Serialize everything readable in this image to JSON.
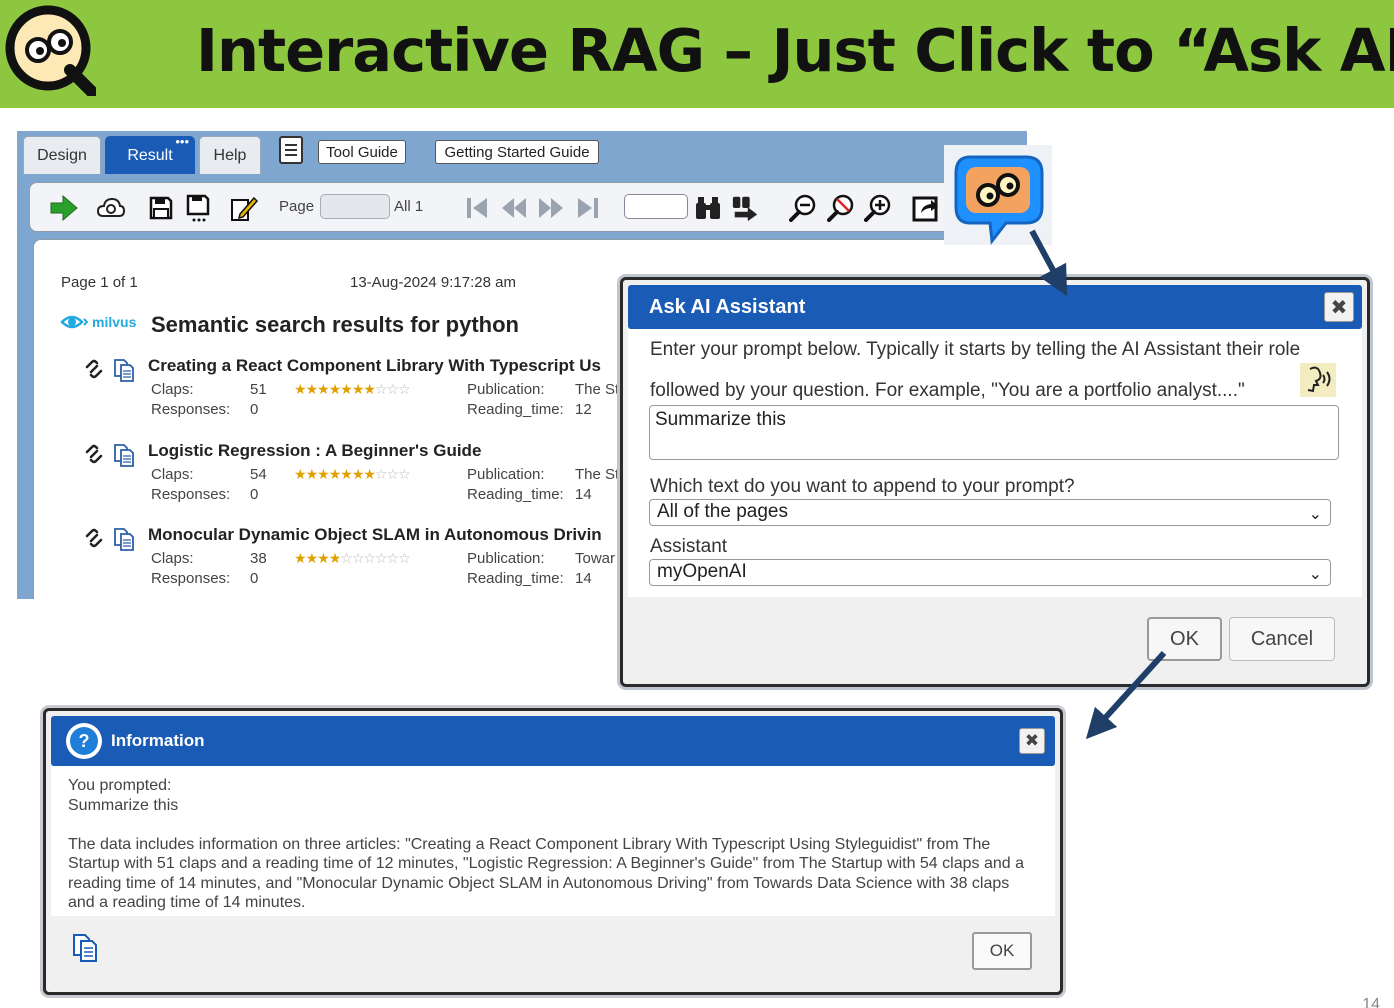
{
  "slide": {
    "title": "Interactive RAG – Just Click to “Ask AI”",
    "page_number": "14",
    "logo_icon": "eyeglasses-q-logo",
    "header_color": "#8dc63f"
  },
  "viewer": {
    "tabs": [
      {
        "label": "Design",
        "active": false
      },
      {
        "label": "Result",
        "active": true
      },
      {
        "label": "Help",
        "active": false
      }
    ],
    "buttons": {
      "tool_guide": "Tool Guide",
      "getting_started": "Getting Started Guide"
    },
    "toolbar": {
      "page_label": "Page",
      "page_value": "",
      "page_all": "All 1",
      "search_value": "",
      "icons": [
        "run-arrow-icon",
        "cloud-settings-icon",
        "save-icon",
        "save-as-icon",
        "edit-icon",
        "first-page-icon",
        "previous-page-icon",
        "next-page-icon",
        "last-page-icon",
        "find-icon",
        "find-next-icon",
        "zoom-out-icon",
        "zoom-reset-icon",
        "zoom-in-icon",
        "export-icon"
      ]
    },
    "report": {
      "page_count": "Page 1 of 1",
      "timestamp": "13-Aug-2024 9:17:28 am",
      "brand": "milvus",
      "title": "Semantic search results for python",
      "labels": {
        "claps": "Claps:",
        "responses": "Responses:",
        "publication": "Publication:",
        "reading_time": "Reading_time:"
      },
      "articles": [
        {
          "title": "Creating a React Component Library With Typescript Us",
          "claps": "51",
          "responses": "0",
          "publication": "The St",
          "reading_time": "12",
          "stars": 7
        },
        {
          "title": "Logistic Regression : A Beginner's Guide",
          "claps": "54",
          "responses": "0",
          "publication": "The St",
          "reading_time": "14",
          "stars": 7
        },
        {
          "title": "Monocular Dynamic Object SLAM in Autonomous Drivin",
          "claps": "38",
          "responses": "0",
          "publication": "Towar",
          "reading_time": "14",
          "stars": 4
        }
      ],
      "stars_total": 10
    }
  },
  "ask_ai": {
    "title": "Ask AI Assistant",
    "instruction_line1": "Enter your prompt below. Typically it starts by telling the AI Assistant their role",
    "instruction_line2": "followed by your question. For example, \"You are a portfolio analyst....\"",
    "prompt_value": "Summarize this",
    "append_label": "Which text do you want to append to your prompt?",
    "append_value": "All of the pages",
    "assistant_label": "Assistant",
    "assistant_value": "myOpenAI",
    "ok": "OK",
    "cancel": "Cancel"
  },
  "info": {
    "title": "Information",
    "prompted_label": "You prompted:",
    "prompted_value": "Summarize this",
    "response": "The data includes information on three articles: \"Creating a React Component Library With Typescript Using Styleguidist\" from The Startup with 51 claps and a reading time of 12 minutes, \"Logistic Regression: A Beginner's Guide\" from The Startup with 54 claps and a reading time of 14 minutes, and \"Monocular Dynamic Object SLAM in Autonomous Driving\" from Towards Data Science with 38 claps and a reading time of 14 minutes.",
    "ok": "OK"
  },
  "colors": {
    "dialog_header": "#1a5bb5",
    "arrow": "#1f3f68",
    "star": "#e0a000"
  }
}
